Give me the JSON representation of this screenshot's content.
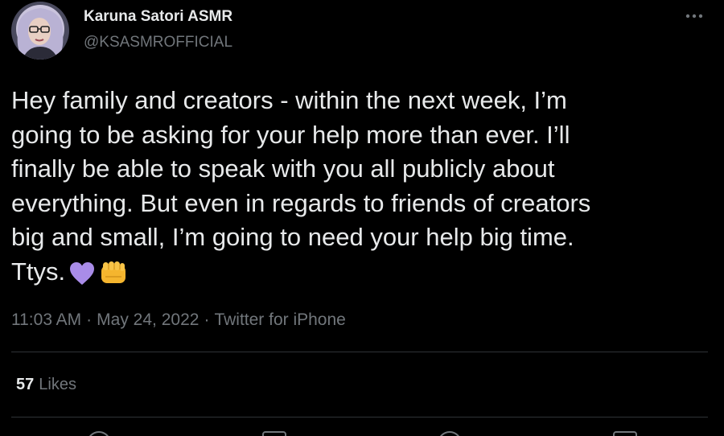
{
  "author": {
    "display_name": "Karuna Satori ASMR",
    "handle": "@KSASMROFFICIAL"
  },
  "more_menu": {
    "icon": "more-horizontal-icon"
  },
  "tweet": {
    "lines": [
      "Hey family and creators - within the next week, I’m",
      "going to be asking for your help more than ever. I’ll",
      "finally be able to speak with you all publicly about",
      "everything. But even in regards to friends of creators",
      "big and small, I’m going to need your help big time.",
      "Ttys."
    ],
    "emojis": [
      "purple-heart-icon",
      "fist-bump-icon"
    ]
  },
  "meta": {
    "time": "11:03 AM",
    "separator": "·",
    "date": "May 24, 2022",
    "source": "Twitter for iPhone"
  },
  "stats": {
    "likes_count": "57",
    "likes_label": "Likes"
  },
  "colors": {
    "background": "#000000",
    "text": "#e7e9ea",
    "secondary": "#71767b",
    "divider": "#2f3336",
    "heart": "#a98ce8",
    "fist": "#f5b52e"
  }
}
